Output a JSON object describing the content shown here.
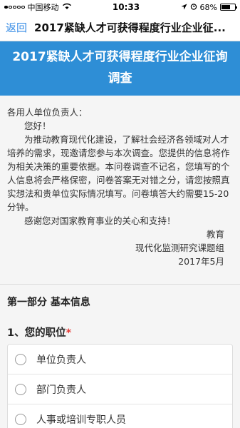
{
  "status_bar": {
    "carrier": "中国移动",
    "time": "10:33",
    "battery": "68%",
    "battery_level": 0.68
  },
  "nav": {
    "back_label": "返回",
    "title": "2017紧缺人才可获得程度行业企业征..."
  },
  "banner": {
    "title": "2017紧缺人才可获得程度行业企业征询调查"
  },
  "intro": {
    "salutation": "各用人单位负责人：",
    "greeting": "您好！",
    "paragraph1": "为推动教育现代化建设，了解社会经济各领域对人才培养的需求，现邀请您参与本次调查。您提供的信息将作为相关决策的重要依据。本问卷调查不记名，您填写的个人信息将会严格保密，问卷答案无对错之分，请您按照真实想法和贵单位实际情况填写。问卷填答大约需要15-20分钟。",
    "paragraph2": "感谢您对国家教育事业的关心和支持！",
    "sign_line1": "教育",
    "sign_line2": "现代化监测研究课题组",
    "sign_date": "2017年5月"
  },
  "section": {
    "title": "第一部分 基本信息"
  },
  "question1": {
    "label": "1、您的职位",
    "required_mark": "*",
    "options": [
      "单位负责人",
      "部门负责人",
      "人事或培训专职人员"
    ]
  }
}
